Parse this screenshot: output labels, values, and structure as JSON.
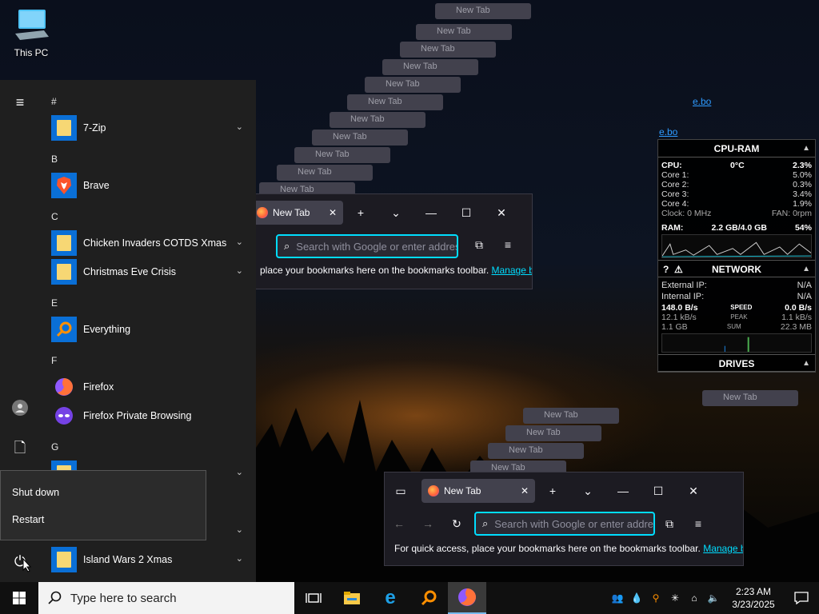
{
  "desktop": {
    "icons": [
      {
        "label": "This PC"
      }
    ]
  },
  "browser": {
    "tab_title": "New Tab",
    "url_placeholder": "Search with Google or enter address",
    "bookmark_text_short": "place your bookmarks here on the bookmarks toolbar.",
    "bookmark_text_full": "For quick access, place your bookmarks here on the bookmarks toolbar.",
    "manage_link": "Manage bo",
    "side_link": "e.bo"
  },
  "gadget": {
    "cpu_ram": {
      "title": "CPU-RAM",
      "cpu_label": "CPU:",
      "cpu_temp": "0°C",
      "cpu_pct": "2.3%",
      "cores": [
        {
          "label": "Core 1:",
          "value": "5.0%"
        },
        {
          "label": "Core 2:",
          "value": "0.3%"
        },
        {
          "label": "Core 3:",
          "value": "3.4%"
        },
        {
          "label": "Core 4:",
          "value": "1.9%"
        }
      ],
      "clock": "Clock: 0 MHz",
      "fan": "FAN: 0rpm",
      "ram_label": "RAM:",
      "ram_value": "2.2 GB/4.0 GB",
      "ram_pct": "54%"
    },
    "network": {
      "title": "NETWORK",
      "ext_label": "External IP:",
      "ext_value": "N/A",
      "int_label": "Internal IP:",
      "int_value": "N/A",
      "speed_left": "148.0 B/s",
      "speed_label": "SPEED",
      "speed_right": "0.0 B/s",
      "peak_left": "12.1 kB/s",
      "peak_label": "PEAK",
      "peak_right": "1.1 kB/s",
      "sum_left": "1.1 GB",
      "sum_label": "SUM",
      "sum_right": "22.3 MB"
    },
    "drives": {
      "title": "DRIVES"
    }
  },
  "startmenu": {
    "groups": [
      {
        "letter": "#",
        "apps": [
          {
            "name": "7-Zip",
            "expand": true
          }
        ]
      },
      {
        "letter": "B",
        "apps": [
          {
            "name": "Brave",
            "expand": false
          }
        ]
      },
      {
        "letter": "C",
        "apps": [
          {
            "name": "Chicken Invaders COTDS Xmas",
            "expand": true
          },
          {
            "name": "Christmas Eve Crisis",
            "expand": true
          }
        ]
      },
      {
        "letter": "E",
        "apps": [
          {
            "name": "Everything",
            "expand": false
          }
        ]
      },
      {
        "letter": "F",
        "apps": [
          {
            "name": "Firefox",
            "expand": false
          },
          {
            "name": "Firefox Private Browsing",
            "expand": false
          }
        ]
      },
      {
        "letter": "G",
        "apps": []
      }
    ],
    "last_app": "Island Wars 2 Xmas",
    "power_menu": {
      "shutdown": "Shut down",
      "restart": "Restart"
    }
  },
  "taskbar": {
    "search_placeholder": "Type here to search",
    "time": "2:23 AM",
    "date": "3/23/2025"
  },
  "colors": {
    "accent": "#00ddff",
    "start_bg": "#1f1f1f",
    "tile_blue": "#0a6fd6"
  }
}
